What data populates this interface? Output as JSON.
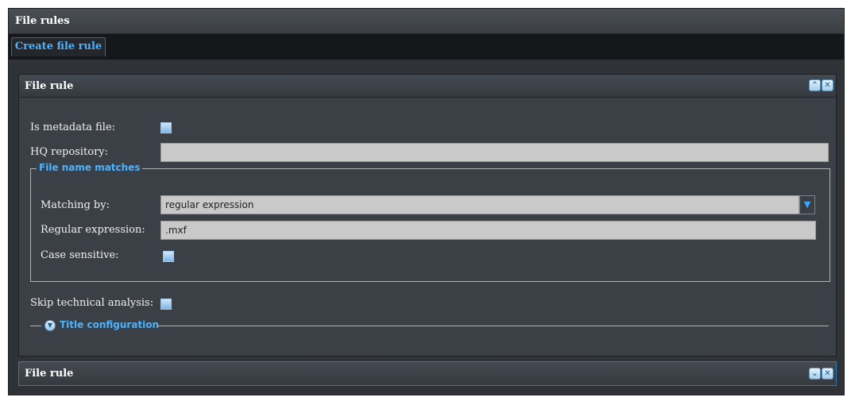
{
  "window": {
    "title": "File rules"
  },
  "tabs": [
    {
      "label": "Create file rule"
    }
  ],
  "panels": [
    {
      "title": "File rule",
      "header_buttons": [
        "collapse-up-icon",
        "close-icon"
      ],
      "fields": {
        "is_metadata_file": {
          "label": "Is metadata file:",
          "checked": false
        },
        "hq_repository": {
          "label": "HQ repository:",
          "value": ""
        },
        "file_name_matches": {
          "legend": "File name matches",
          "matching_by": {
            "label": "Matching by:",
            "value": "regular expression"
          },
          "regular_expression": {
            "label": "Regular expression:",
            "value": ".mxf"
          },
          "case_sensitive": {
            "label": "Case sensitive:",
            "checked": false
          }
        },
        "skip_technical_analysis": {
          "label": "Skip technical analysis:",
          "checked": false
        },
        "title_configuration": {
          "label": "Title configuration",
          "expanded": false
        }
      }
    },
    {
      "title": "File rule",
      "header_buttons": [
        "expand-down-icon",
        "close-icon"
      ]
    }
  ],
  "colors": {
    "accent": "#4db3ff",
    "panel": "#3b4046",
    "input": "#c9c9c9"
  }
}
